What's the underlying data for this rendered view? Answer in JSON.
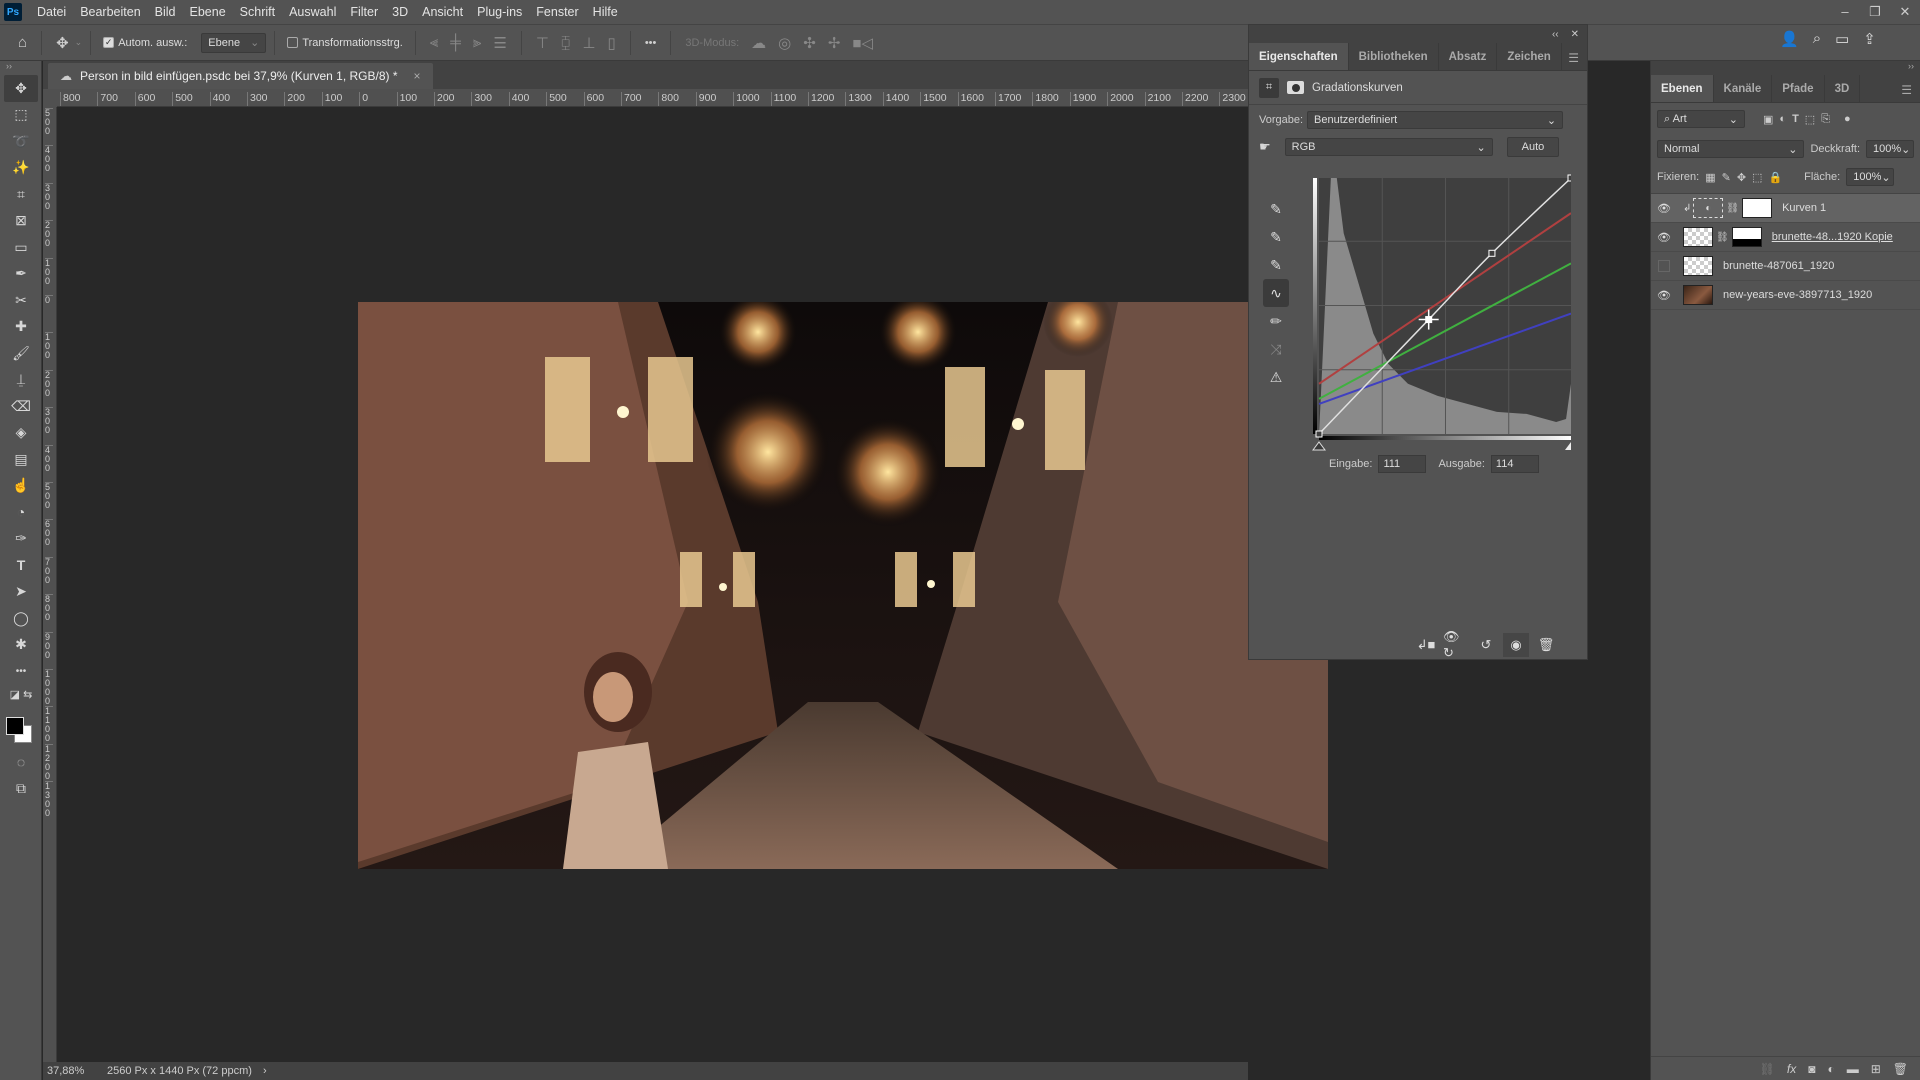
{
  "app": {
    "logo": "Ps"
  },
  "menu": [
    "Datei",
    "Bearbeiten",
    "Bild",
    "Ebene",
    "Schrift",
    "Auswahl",
    "Filter",
    "3D",
    "Ansicht",
    "Plug-ins",
    "Fenster",
    "Hilfe"
  ],
  "window_controls": {
    "minimize": "–",
    "restore": "❐",
    "close": "✕"
  },
  "options_bar": {
    "auto_select_label": "Autom. ausw.:",
    "auto_select_checked": true,
    "auto_select_target": "Ebene",
    "transform_label": "Transformationsstrg.",
    "transform_checked": false,
    "more": "•••",
    "mode_3d_label": "3D-Modus:"
  },
  "document": {
    "tab_title": "Person in bild einfügen.psdc bei 37,9% (Kurven 1, RGB/8) *",
    "close": "×",
    "zoom": "37,88%",
    "dimensions": "2560 Px x 1440 Px (72 ppcm)",
    "status_arrow": "›"
  },
  "rulers": {
    "horizontal": [
      "800",
      "700",
      "600",
      "500",
      "400",
      "300",
      "200",
      "100",
      "0",
      "100",
      "200",
      "300",
      "400",
      "500",
      "600",
      "700",
      "800",
      "900",
      "1000",
      "1100",
      "1200",
      "1300",
      "1400",
      "1500",
      "1600",
      "1700",
      "1800",
      "1900",
      "2000",
      "2100",
      "2200",
      "2300"
    ],
    "vertical": [
      "500",
      "400",
      "300",
      "200",
      "100",
      "0",
      "100",
      "200",
      "300",
      "400",
      "500",
      "600",
      "700",
      "800",
      "900",
      "1000",
      "1100",
      "1200",
      "1300"
    ]
  },
  "tools": [
    "move",
    "marquee",
    "lasso",
    "magic-wand",
    "crop",
    "frame",
    "ruler",
    "eyedropper",
    "spot-heal",
    "healing",
    "brush",
    "stamp",
    "eraser",
    "fill",
    "gradient",
    "smudge",
    "dodge",
    "pen",
    "type",
    "path-select",
    "ellipse",
    "custom-shape",
    "more"
  ],
  "properties": {
    "tabs": [
      "Eigenschaften",
      "Bibliotheken",
      "Absatz",
      "Zeichen"
    ],
    "active_tab": 0,
    "title": "Gradationskurven",
    "preset_label": "Vorgabe:",
    "preset_value": "Benutzerdefiniert",
    "channel": "RGB",
    "auto_label": "Auto",
    "input_label": "Eingabe:",
    "input_value": "111",
    "output_label": "Ausgabe:",
    "output_value": "114",
    "curves": {
      "rgb": [
        [
          0,
          0
        ],
        [
          111,
          114
        ],
        [
          175,
          180
        ],
        [
          255,
          255
        ]
      ],
      "red": [
        [
          0,
          50
        ],
        [
          255,
          220
        ]
      ],
      "green": [
        [
          0,
          35
        ],
        [
          255,
          170
        ]
      ],
      "blue": [
        [
          0,
          30
        ],
        [
          255,
          120
        ]
      ],
      "colors": {
        "rgb": "#e0e0e0",
        "red": "#b04040",
        "green": "#40b040",
        "blue": "#4040c0"
      }
    }
  },
  "layers": {
    "tabs": [
      "Ebenen",
      "Kanäle",
      "Pfade",
      "3D"
    ],
    "active_tab": 0,
    "filter": "Art",
    "blend_mode": "Normal",
    "opacity_label": "Deckkraft:",
    "opacity": "100%",
    "lock_label": "Fixieren:",
    "fill_label": "Fläche:",
    "fill": "100%",
    "items": [
      {
        "name": "Kurven 1",
        "visible": true,
        "selected": true,
        "type": "adjustment"
      },
      {
        "name": "brunette-48...1920 Kopie",
        "visible": true,
        "selected": false,
        "type": "masked"
      },
      {
        "name": "brunette-487061_1920",
        "visible": false,
        "selected": false,
        "type": "smart"
      },
      {
        "name": "new-years-eve-3897713_1920",
        "visible": true,
        "selected": false,
        "type": "smart-photo"
      }
    ]
  }
}
